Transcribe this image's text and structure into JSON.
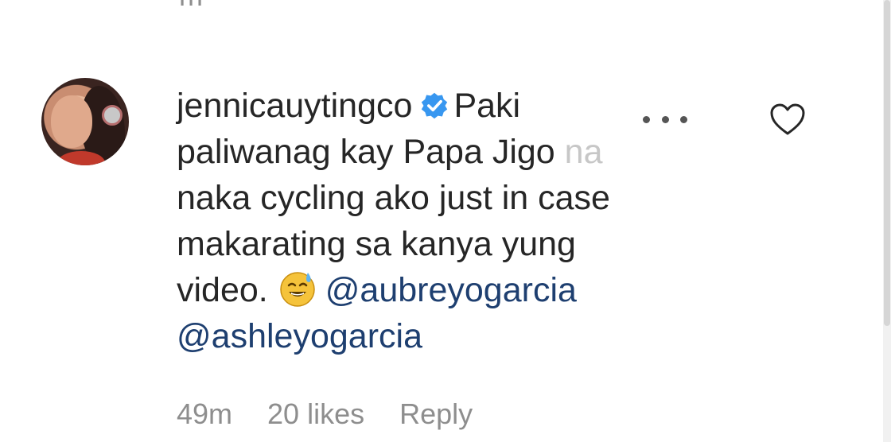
{
  "previous_comment": {
    "time_fragment": "m"
  },
  "comment": {
    "username": "jennicauytingco",
    "verified": true,
    "text_line1": "Paki",
    "text_line2": "paliwanag kay Papa Jigo ",
    "text_line2_faded": "na",
    "text_line3": "naka cycling ako just in case",
    "text_line4": "makarating sa kanya yung",
    "text_line5": "video.",
    "emoji": "sweat-smile-emoji",
    "mention1": "@aubreyogarcia",
    "mention2": "@ashleyogarcia"
  },
  "meta": {
    "time": "49m",
    "likes": "20 likes",
    "reply": "Reply"
  },
  "icons": {
    "more": "more-options-icon",
    "like": "heart-icon",
    "verified": "verified-badge-icon"
  },
  "colors": {
    "text": "#262626",
    "secondary": "#8e8e8e",
    "mention": "#1e3f70",
    "verified": "#3897f0"
  }
}
